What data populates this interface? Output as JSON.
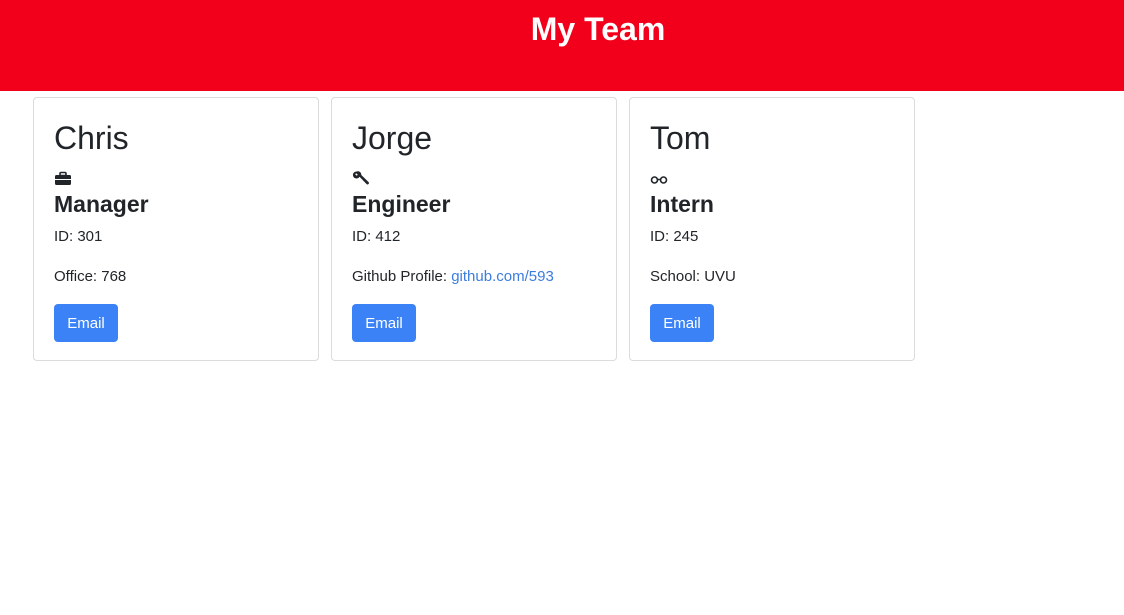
{
  "header": {
    "title": "My Team"
  },
  "cards": [
    {
      "name": "Chris",
      "icon": "briefcase-icon",
      "role": "Manager",
      "id_text": "ID: 301",
      "extra_label": "Office: 768",
      "email_label": "Email"
    },
    {
      "name": "Jorge",
      "icon": "wrench-icon",
      "role": "Engineer",
      "id_text": "ID: 412",
      "extra_label": "Github Profile: ",
      "extra_link": "github.com/593",
      "email_label": "Email"
    },
    {
      "name": "Tom",
      "icon": "glasses-icon",
      "role": "Intern",
      "id_text": "ID: 245",
      "extra_label": "School: UVU",
      "email_label": "Email"
    }
  ],
  "colors": {
    "header": "#f2001b",
    "button": "#3b82f6",
    "link": "#3b7ddd"
  }
}
